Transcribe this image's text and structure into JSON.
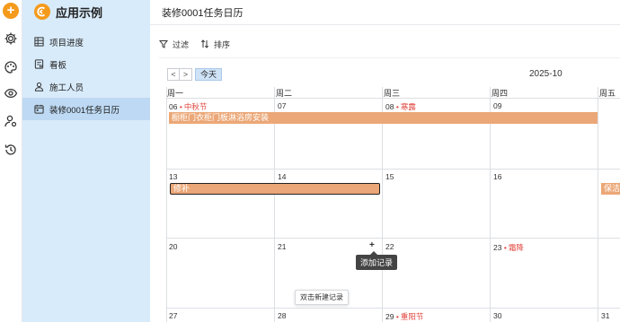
{
  "app": {
    "title": "应用示例",
    "brand_color": "#f59a1b"
  },
  "rail": {
    "icons": [
      "add-icon",
      "settings-icon",
      "palette-icon",
      "eye-icon",
      "user-settings-icon",
      "history-icon"
    ]
  },
  "sidebar": {
    "items": [
      {
        "label": "项目进度",
        "icon": "grid-icon"
      },
      {
        "label": "看板",
        "icon": "board-icon"
      },
      {
        "label": "施工人员",
        "icon": "person-icon"
      },
      {
        "label": "装修0001任务日历",
        "icon": "calendar-icon",
        "active": true
      }
    ]
  },
  "page": {
    "title": "装修0001任务日历"
  },
  "toolbar": {
    "filter_label": "过滤",
    "sort_label": "排序"
  },
  "calendar": {
    "prev_label": "<",
    "next_label": ">",
    "today_label": "今天",
    "month": "2025-10",
    "weekdays": [
      "周一",
      "周二",
      "周三",
      "周四",
      "周五"
    ],
    "weeks": [
      {
        "days": [
          "06",
          "07",
          "08",
          "09",
          ""
        ],
        "holidays": {
          "0": "中秋节",
          "2": "寒露"
        }
      },
      {
        "days": [
          "13",
          "14",
          "15",
          "16",
          ""
        ],
        "holidays": {}
      },
      {
        "days": [
          "20",
          "21",
          "22",
          "23",
          ""
        ],
        "holidays": {
          "3": "霜降"
        }
      },
      {
        "days": [
          "27",
          "28",
          "29",
          "30",
          "31"
        ],
        "holidays": {
          "2": "重阳节"
        }
      }
    ],
    "events": [
      {
        "title": "橱柜门衣柜门板淋浴房安装",
        "color": "#eba777"
      },
      {
        "title": "修补",
        "color": "#eba777",
        "selected": true
      },
      {
        "title": "保洁",
        "color": "#eba777"
      }
    ],
    "add_button": "+",
    "tooltip": "添加记录",
    "dblclick_hint": "双击新建记录"
  }
}
